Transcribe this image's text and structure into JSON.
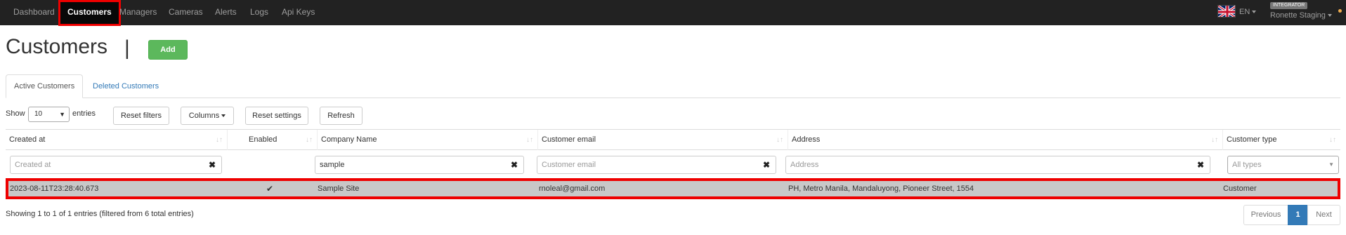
{
  "nav": {
    "items": [
      {
        "label": "Dashboard"
      },
      {
        "label": "Customers"
      },
      {
        "label": "Managers"
      },
      {
        "label": "Cameras"
      },
      {
        "label": "Alerts"
      },
      {
        "label": "Logs"
      },
      {
        "label": "Api Keys"
      }
    ],
    "active": "Customers",
    "language": "EN",
    "role_badge": "INTEGRATOR",
    "user_name": "Ronette Staging"
  },
  "page": {
    "title": "Customers",
    "separator": "|",
    "add_label": "Add"
  },
  "tabs": [
    {
      "label": "Active Customers",
      "active": true
    },
    {
      "label": "Deleted Customers",
      "active": false
    }
  ],
  "toolbar": {
    "show_label": "Show",
    "entries_value": "10",
    "entries_label": "entries",
    "reset_filters": "Reset filters",
    "columns": "Columns",
    "reset_settings": "Reset settings",
    "refresh": "Refresh"
  },
  "table": {
    "columns": [
      "Created at",
      "Enabled",
      "Company Name",
      "Customer email",
      "Address",
      "Customer type"
    ],
    "filters": {
      "created_at": "Created at",
      "company_name_value": "sample",
      "customer_email": "Customer email",
      "address": "Address",
      "customer_type": "All types"
    },
    "rows": [
      {
        "created_at": "2023-08-11T23:28:40.673",
        "enabled": true,
        "company_name": "Sample Site",
        "customer_email": "rnoleal@gmail.com",
        "address": "PH, Metro Manila, Mandaluyong, Pioneer Street, 1554",
        "customer_type": "Customer"
      }
    ]
  },
  "footer": {
    "info": "Showing 1 to 1 of 1 entries (filtered from 6 total entries)",
    "previous": "Previous",
    "page": "1",
    "next": "Next"
  },
  "colors": {
    "navbar": "#222222",
    "add_button": "#5cb85c",
    "link": "#337ab7",
    "highlight": "#ee0000",
    "row_bg": "#c8c8c8"
  }
}
